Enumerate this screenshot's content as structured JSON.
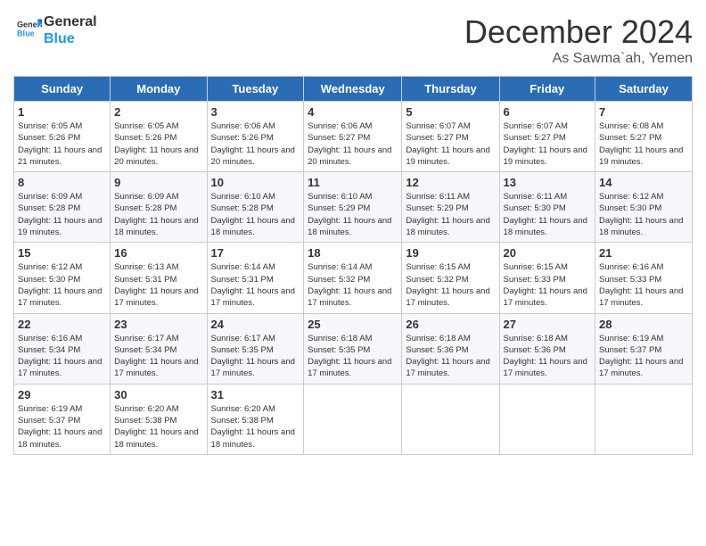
{
  "logo": {
    "line1": "General",
    "line2": "Blue"
  },
  "title": {
    "month": "December 2024",
    "location": "As Sawma`ah, Yemen"
  },
  "headers": [
    "Sunday",
    "Monday",
    "Tuesday",
    "Wednesday",
    "Thursday",
    "Friday",
    "Saturday"
  ],
  "weeks": [
    [
      {
        "day": "1",
        "sunrise": "Sunrise: 6:05 AM",
        "sunset": "Sunset: 5:26 PM",
        "daylight": "Daylight: 11 hours and 21 minutes."
      },
      {
        "day": "2",
        "sunrise": "Sunrise: 6:05 AM",
        "sunset": "Sunset: 5:26 PM",
        "daylight": "Daylight: 11 hours and 20 minutes."
      },
      {
        "day": "3",
        "sunrise": "Sunrise: 6:06 AM",
        "sunset": "Sunset: 5:26 PM",
        "daylight": "Daylight: 11 hours and 20 minutes."
      },
      {
        "day": "4",
        "sunrise": "Sunrise: 6:06 AM",
        "sunset": "Sunset: 5:27 PM",
        "daylight": "Daylight: 11 hours and 20 minutes."
      },
      {
        "day": "5",
        "sunrise": "Sunrise: 6:07 AM",
        "sunset": "Sunset: 5:27 PM",
        "daylight": "Daylight: 11 hours and 19 minutes."
      },
      {
        "day": "6",
        "sunrise": "Sunrise: 6:07 AM",
        "sunset": "Sunset: 5:27 PM",
        "daylight": "Daylight: 11 hours and 19 minutes."
      },
      {
        "day": "7",
        "sunrise": "Sunrise: 6:08 AM",
        "sunset": "Sunset: 5:27 PM",
        "daylight": "Daylight: 11 hours and 19 minutes."
      }
    ],
    [
      {
        "day": "8",
        "sunrise": "Sunrise: 6:09 AM",
        "sunset": "Sunset: 5:28 PM",
        "daylight": "Daylight: 11 hours and 19 minutes."
      },
      {
        "day": "9",
        "sunrise": "Sunrise: 6:09 AM",
        "sunset": "Sunset: 5:28 PM",
        "daylight": "Daylight: 11 hours and 18 minutes."
      },
      {
        "day": "10",
        "sunrise": "Sunrise: 6:10 AM",
        "sunset": "Sunset: 5:28 PM",
        "daylight": "Daylight: 11 hours and 18 minutes."
      },
      {
        "day": "11",
        "sunrise": "Sunrise: 6:10 AM",
        "sunset": "Sunset: 5:29 PM",
        "daylight": "Daylight: 11 hours and 18 minutes."
      },
      {
        "day": "12",
        "sunrise": "Sunrise: 6:11 AM",
        "sunset": "Sunset: 5:29 PM",
        "daylight": "Daylight: 11 hours and 18 minutes."
      },
      {
        "day": "13",
        "sunrise": "Sunrise: 6:11 AM",
        "sunset": "Sunset: 5:30 PM",
        "daylight": "Daylight: 11 hours and 18 minutes."
      },
      {
        "day": "14",
        "sunrise": "Sunrise: 6:12 AM",
        "sunset": "Sunset: 5:30 PM",
        "daylight": "Daylight: 11 hours and 18 minutes."
      }
    ],
    [
      {
        "day": "15",
        "sunrise": "Sunrise: 6:12 AM",
        "sunset": "Sunset: 5:30 PM",
        "daylight": "Daylight: 11 hours and 17 minutes."
      },
      {
        "day": "16",
        "sunrise": "Sunrise: 6:13 AM",
        "sunset": "Sunset: 5:31 PM",
        "daylight": "Daylight: 11 hours and 17 minutes."
      },
      {
        "day": "17",
        "sunrise": "Sunrise: 6:14 AM",
        "sunset": "Sunset: 5:31 PM",
        "daylight": "Daylight: 11 hours and 17 minutes."
      },
      {
        "day": "18",
        "sunrise": "Sunrise: 6:14 AM",
        "sunset": "Sunset: 5:32 PM",
        "daylight": "Daylight: 11 hours and 17 minutes."
      },
      {
        "day": "19",
        "sunrise": "Sunrise: 6:15 AM",
        "sunset": "Sunset: 5:32 PM",
        "daylight": "Daylight: 11 hours and 17 minutes."
      },
      {
        "day": "20",
        "sunrise": "Sunrise: 6:15 AM",
        "sunset": "Sunset: 5:33 PM",
        "daylight": "Daylight: 11 hours and 17 minutes."
      },
      {
        "day": "21",
        "sunrise": "Sunrise: 6:16 AM",
        "sunset": "Sunset: 5:33 PM",
        "daylight": "Daylight: 11 hours and 17 minutes."
      }
    ],
    [
      {
        "day": "22",
        "sunrise": "Sunrise: 6:16 AM",
        "sunset": "Sunset: 5:34 PM",
        "daylight": "Daylight: 11 hours and 17 minutes."
      },
      {
        "day": "23",
        "sunrise": "Sunrise: 6:17 AM",
        "sunset": "Sunset: 5:34 PM",
        "daylight": "Daylight: 11 hours and 17 minutes."
      },
      {
        "day": "24",
        "sunrise": "Sunrise: 6:17 AM",
        "sunset": "Sunset: 5:35 PM",
        "daylight": "Daylight: 11 hours and 17 minutes."
      },
      {
        "day": "25",
        "sunrise": "Sunrise: 6:18 AM",
        "sunset": "Sunset: 5:35 PM",
        "daylight": "Daylight: 11 hours and 17 minutes."
      },
      {
        "day": "26",
        "sunrise": "Sunrise: 6:18 AM",
        "sunset": "Sunset: 5:36 PM",
        "daylight": "Daylight: 11 hours and 17 minutes."
      },
      {
        "day": "27",
        "sunrise": "Sunrise: 6:18 AM",
        "sunset": "Sunset: 5:36 PM",
        "daylight": "Daylight: 11 hours and 17 minutes."
      },
      {
        "day": "28",
        "sunrise": "Sunrise: 6:19 AM",
        "sunset": "Sunset: 5:37 PM",
        "daylight": "Daylight: 11 hours and 17 minutes."
      }
    ],
    [
      {
        "day": "29",
        "sunrise": "Sunrise: 6:19 AM",
        "sunset": "Sunset: 5:37 PM",
        "daylight": "Daylight: 11 hours and 18 minutes."
      },
      {
        "day": "30",
        "sunrise": "Sunrise: 6:20 AM",
        "sunset": "Sunset: 5:38 PM",
        "daylight": "Daylight: 11 hours and 18 minutes."
      },
      {
        "day": "31",
        "sunrise": "Sunrise: 6:20 AM",
        "sunset": "Sunset: 5:38 PM",
        "daylight": "Daylight: 11 hours and 18 minutes."
      },
      null,
      null,
      null,
      null
    ]
  ]
}
